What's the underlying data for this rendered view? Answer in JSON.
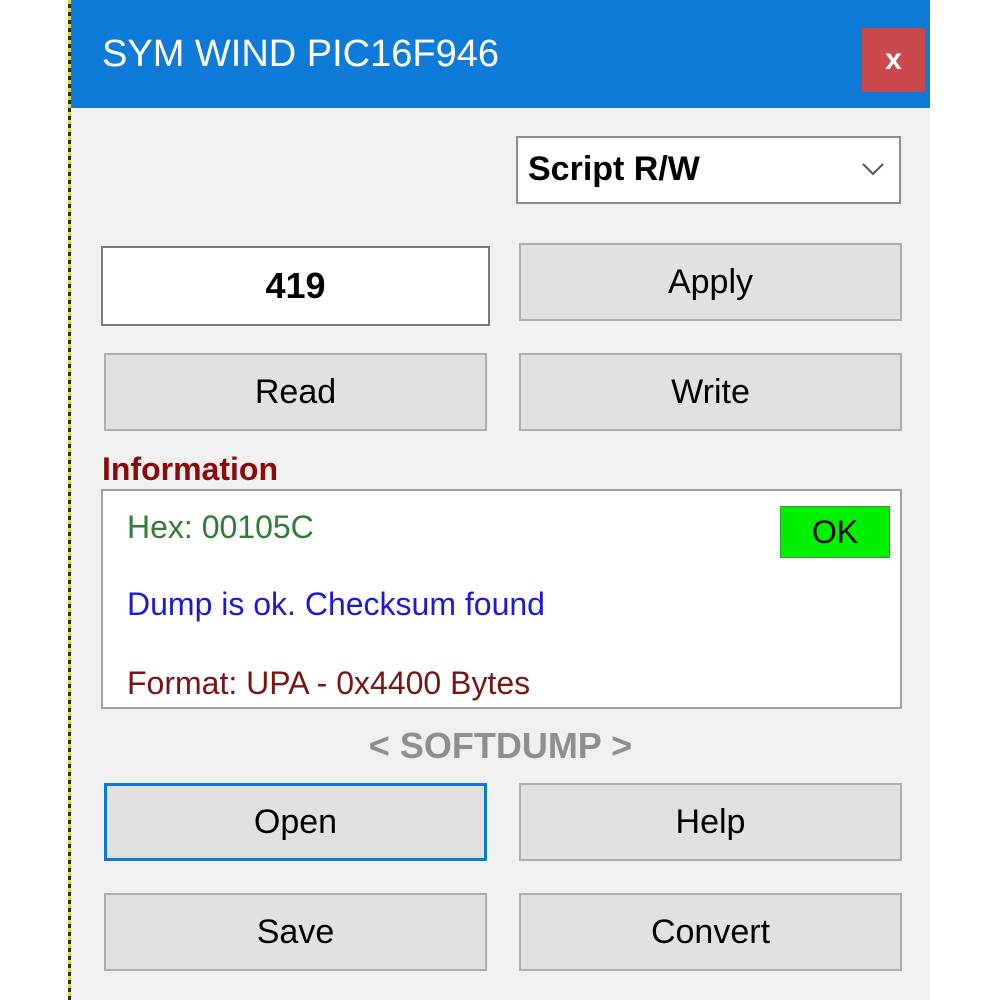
{
  "window": {
    "title": "SYM WIND PIC16F946",
    "close_label": "x"
  },
  "mode_select": {
    "selected": "Script R/W"
  },
  "value_field": {
    "value": "419"
  },
  "buttons": {
    "apply": "Apply",
    "read": "Read",
    "write": "Write",
    "open": "Open",
    "help": "Help",
    "save": "Save",
    "convert": "Convert"
  },
  "information": {
    "label": "Information",
    "hex": "Hex: 00105C",
    "status": "Dump is ok. Checksum found",
    "format": "Format: UPA - 0x4400 Bytes",
    "badge": "OK"
  },
  "brand": "< SOFTDUMP >",
  "colors": {
    "titlebar": "#0f7bd8",
    "close": "#c9494d",
    "info_label": "#8a0a0a",
    "hex_text": "#2e7d32",
    "status_text": "#1a1ad6",
    "format_text": "#7a1414",
    "ok_badge": "#00f000",
    "focus_border": "#0f78d7"
  },
  "icons": {
    "dropdown": "chevron-down-icon"
  }
}
